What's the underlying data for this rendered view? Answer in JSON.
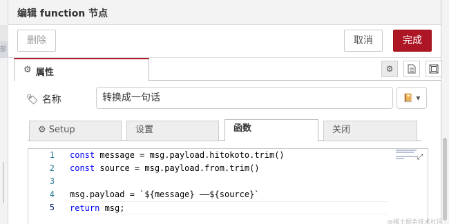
{
  "background": {
    "strip_label": "部"
  },
  "tray": {
    "title": "编辑 function 节点"
  },
  "toolbar": {
    "delete_label": "删除",
    "cancel_label": "取消",
    "done_label": "完成",
    "accent_color": "#ad1625"
  },
  "prop_tabs": {
    "properties_label": "属性",
    "icons": [
      "gear-icon",
      "description-icon",
      "appearance-icon"
    ]
  },
  "name_field": {
    "label": "名称",
    "value": "转换成一句话",
    "icon": "tag-icon",
    "select_icon": "book-icon"
  },
  "inner_tabs": [
    {
      "label": "Setup",
      "icon": "gear-icon",
      "active": false
    },
    {
      "label": "设置",
      "active": false
    },
    {
      "label": "函数",
      "active": true
    },
    {
      "label": "关闭",
      "active": false
    }
  ],
  "editor": {
    "line_numbers": [
      "1",
      "2",
      "3",
      "4",
      "5"
    ],
    "lines": [
      {
        "kw": "const",
        "rest": " message = msg.payload.hitokoto.trim()"
      },
      {
        "kw": "const",
        "rest": " source = msg.payload.from.trim()"
      },
      {
        "kw": "",
        "rest": ""
      },
      {
        "kw": "",
        "rest": "msg.payload = `${message} ——${source}`"
      },
      {
        "kw": "return",
        "rest": " msg;"
      }
    ]
  },
  "watermark": "@稀土掘金技术社区"
}
